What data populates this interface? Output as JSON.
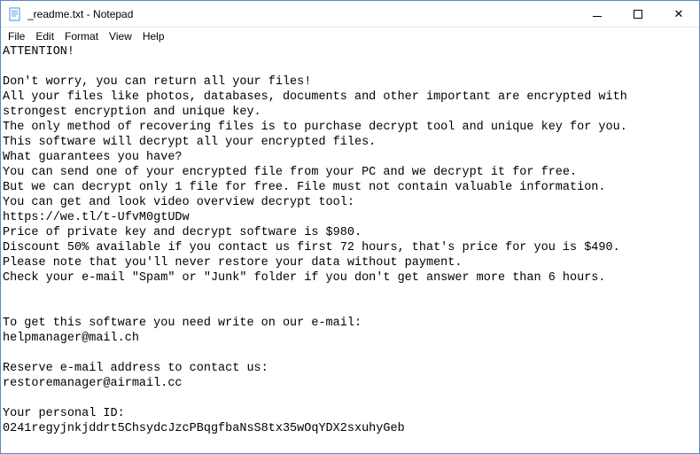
{
  "window": {
    "title": "_readme.txt - Notepad"
  },
  "menu": {
    "file": "File",
    "edit": "Edit",
    "format": "Format",
    "view": "View",
    "help": "Help"
  },
  "doc": {
    "text": "ATTENTION!\n\nDon't worry, you can return all your files!\nAll your files like photos, databases, documents and other important are encrypted with strongest encryption and unique key.\nThe only method of recovering files is to purchase decrypt tool and unique key for you.\nThis software will decrypt all your encrypted files.\nWhat guarantees you have?\nYou can send one of your encrypted file from your PC and we decrypt it for free.\nBut we can decrypt only 1 file for free. File must not contain valuable information.\nYou can get and look video overview decrypt tool:\nhttps://we.tl/t-UfvM0gtUDw\nPrice of private key and decrypt software is $980.\nDiscount 50% available if you contact us first 72 hours, that's price for you is $490.\nPlease note that you'll never restore your data without payment.\nCheck your e-mail \"Spam\" or \"Junk\" folder if you don't get answer more than 6 hours.\n\n\nTo get this software you need write on our e-mail:\nhelpmanager@mail.ch\n\nReserve e-mail address to contact us:\nrestoremanager@airmail.cc\n\nYour personal ID:\n0241regyjnkjddrt5ChsydcJzcPBqgfbaNsS8tx35wOqYDX2sxuhyGeb"
  }
}
